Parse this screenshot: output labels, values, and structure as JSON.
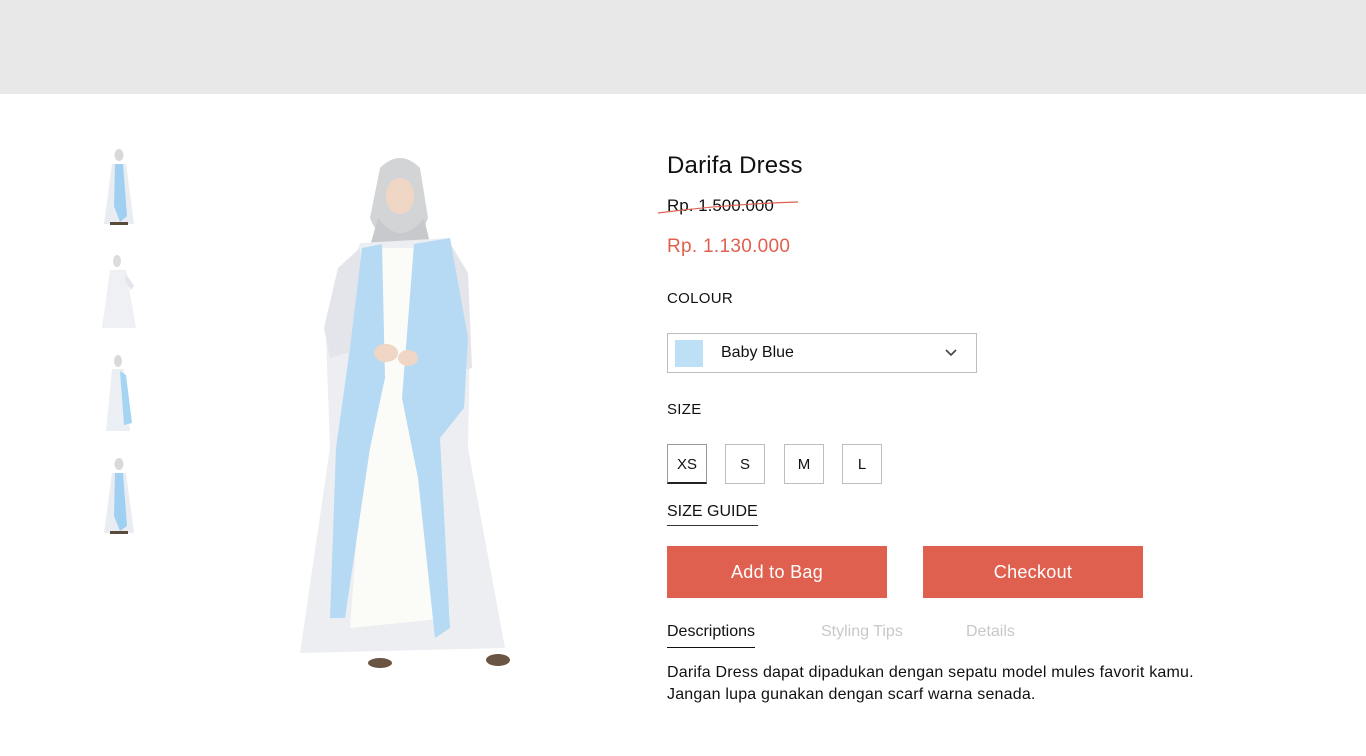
{
  "product": {
    "title": "Darifa Dress",
    "original_price": "Rp. 1.500.000",
    "sale_price": "Rp. 1.130.000"
  },
  "colour": {
    "label": "COLOUR",
    "selected_value": "Baby Blue",
    "selected_swatch": "#bde0f7"
  },
  "size": {
    "label": "SIZE",
    "options": [
      "XS",
      "S",
      "M",
      "L"
    ],
    "selected": "XS",
    "guide_label": "SIZE GUIDE"
  },
  "actions": {
    "add_to_bag": "Add to Bag",
    "checkout": "Checkout"
  },
  "tabs": {
    "items": [
      "Descriptions",
      "Styling Tips",
      "Details"
    ],
    "active": "Descriptions"
  },
  "description": {
    "line1": "Darifa Dress dapat dipadukan dengan sepatu model mules favorit kamu.",
    "line2": "Jangan lupa gunakan dengan scarf warna senada."
  },
  "colors": {
    "accent": "#e06050",
    "topbar": "#e8e8e8",
    "dress_blue": "#b9dcf5"
  }
}
